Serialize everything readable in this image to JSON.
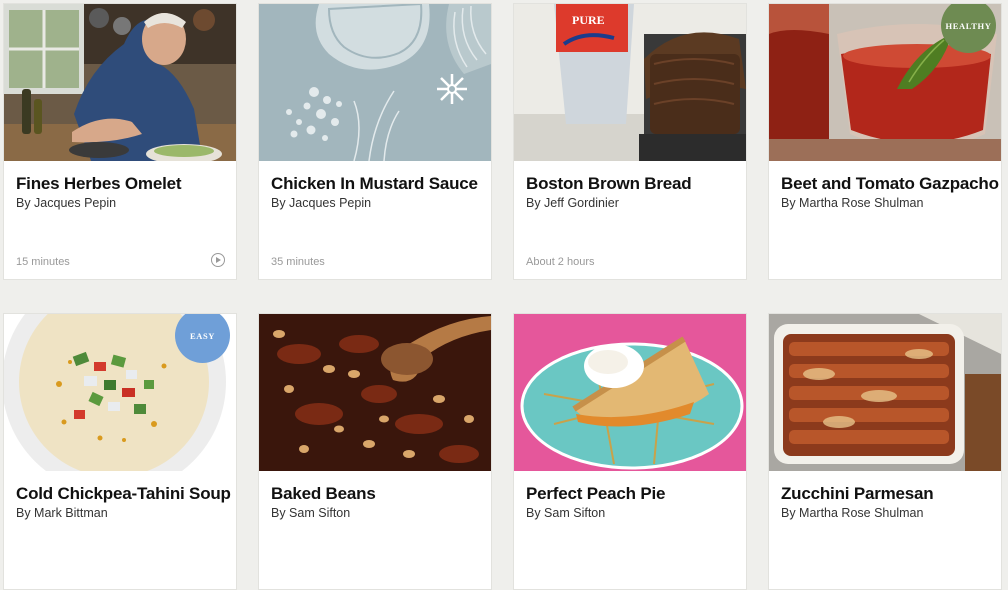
{
  "colors": {
    "background": "#efefec",
    "healthy_badge": "#6e8b52",
    "easy_badge": "#6f9fd8"
  },
  "recipes": [
    {
      "title": "Fines Herbes Omelet",
      "author": "By Jacques Pepin",
      "time": "15 minutes",
      "video": true,
      "badge": ""
    },
    {
      "title": "Chicken In Mustard Sauce",
      "author": "By Jacques Pepin",
      "time": "35 minutes",
      "video": false,
      "badge": ""
    },
    {
      "title": "Boston Brown Bread",
      "author": "By Jeff Gordinier",
      "time": "About 2 hours",
      "video": false,
      "badge": ""
    },
    {
      "title": "Beet and Tomato Gazpacho",
      "author": "By Martha Rose Shulman",
      "time": "",
      "video": false,
      "badge": "HEALTHY"
    },
    {
      "title": "Cold Chickpea-Tahini Soup",
      "author": "By Mark Bittman",
      "time": "",
      "video": false,
      "badge": "EASY"
    },
    {
      "title": "Baked Beans",
      "author": "By Sam Sifton",
      "time": "",
      "video": false,
      "badge": ""
    },
    {
      "title": "Perfect Peach Pie",
      "author": "By Sam Sifton",
      "time": "",
      "video": false,
      "badge": ""
    },
    {
      "title": "Zucchini Parmesan",
      "author": "By Martha Rose Shulman",
      "time": "",
      "video": false,
      "badge": ""
    }
  ]
}
